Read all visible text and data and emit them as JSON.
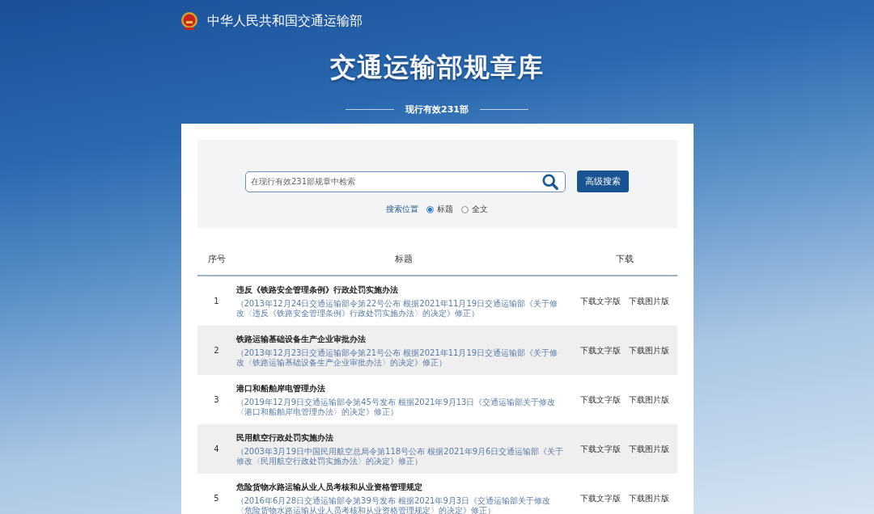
{
  "header": {
    "ministry": "中华人民共和国交通运输部",
    "title": "交通运输部规章库",
    "subtitle": "现行有效231部"
  },
  "search": {
    "placeholder": "在现行有效231部规章中检索",
    "advanced_button": "高级搜索",
    "scope_label": "搜索位置",
    "scope_options": [
      {
        "label": "标题",
        "selected": true
      },
      {
        "label": "全文",
        "selected": false
      }
    ]
  },
  "table": {
    "columns": [
      "序号",
      "标题",
      "下载"
    ],
    "rows": [
      {
        "index": "1",
        "title": "违反《铁路安全管理条例》行政处罚实施办法",
        "note": "（2013年12月24日交通运输部令第22号公布 根据2021年11月19日交通运输部《关于修改〈违反《铁路安全管理条例》行政处罚实施办法〉的决定》修正）",
        "downloads": [
          "下载文字版",
          "下载图片版"
        ]
      },
      {
        "index": "2",
        "title": "铁路运输基础设备生产企业审批办法",
        "note": "（2013年12月23日交通运输部令第21号公布 根据2021年11月19日交通运输部《关于修改〈铁路运输基础设备生产企业审批办法〉的决定》修正）",
        "downloads": [
          "下载文字版",
          "下载图片版"
        ]
      },
      {
        "index": "3",
        "title": "港口和船舶岸电管理办法",
        "note": "（2019年12月9日交通运输部令第45号发布 根据2021年9月13日《交通运输部关于修改〈港口和船舶岸电管理办法〉的决定》修正）",
        "downloads": [
          "下载文字版",
          "下载图片版"
        ]
      },
      {
        "index": "4",
        "title": "民用航空行政处罚实施办法",
        "note": "（2003年3月19日中国民用航空总局令第118号公布 根据2021年9月6日交通运输部《关于修改〈民用航空行政处罚实施办法〉的决定》修正）",
        "downloads": [
          "下载文字版",
          "下载图片版"
        ]
      },
      {
        "index": "5",
        "title": "危险货物水路运输从业人员考核和从业资格管理规定",
        "note": "（2016年6月28日交通运输部令第39号发布 根据2021年9月3日《交通运输部关于修改〈危险货物水路运输从业人员考核和从业资格管理规定〉的决定》修正）",
        "downloads": [
          "下载文字版",
          "下载图片版"
        ]
      }
    ]
  }
}
